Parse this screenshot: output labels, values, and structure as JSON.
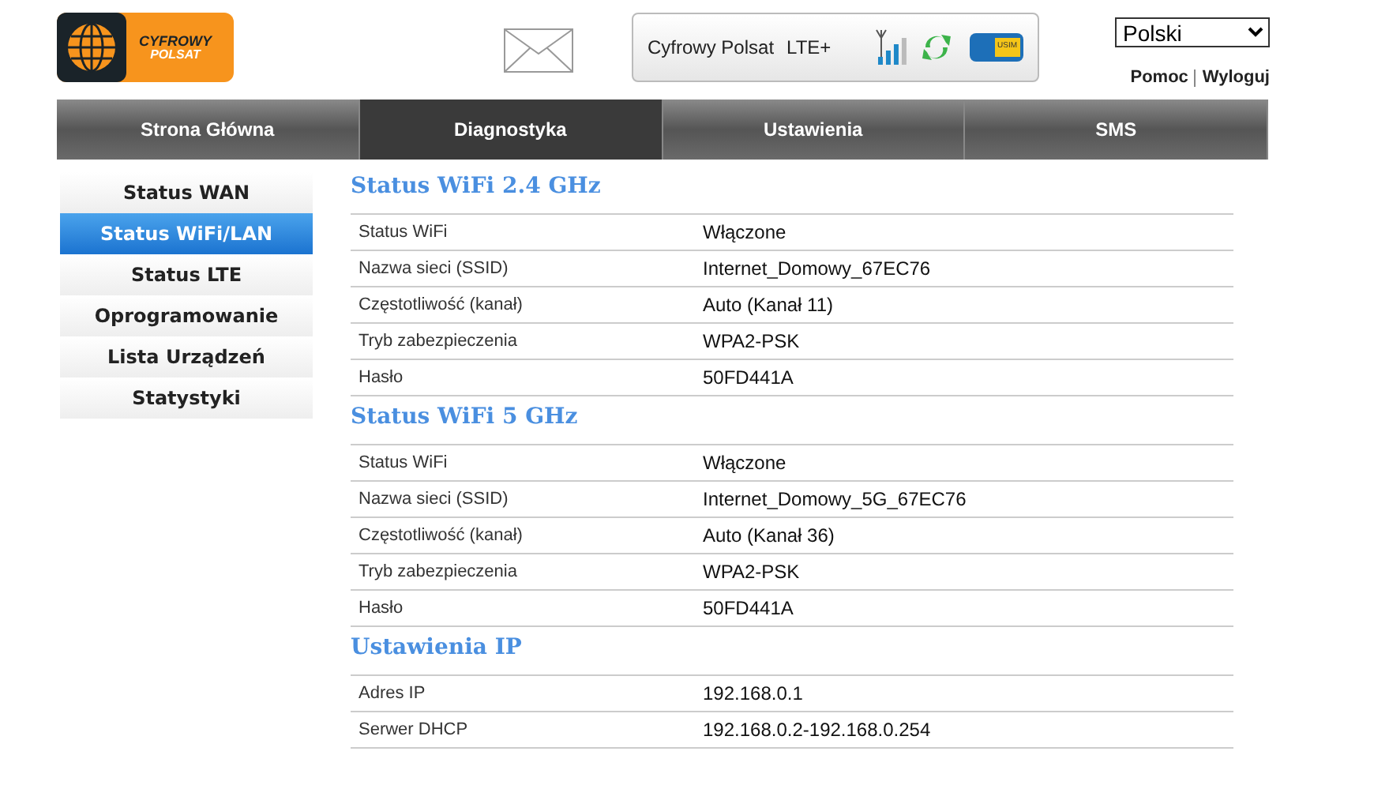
{
  "logo": {
    "line_1": "CYFROWY",
    "line_2": "POLSAT"
  },
  "status_box": {
    "operator": "Cyfrowy Polsat",
    "network": "LTE+",
    "sim": "USIM"
  },
  "language": {
    "value": "Polski"
  },
  "links": [
    "Pomoc",
    "Wyloguj"
  ],
  "tabs": [
    {
      "label": "Strona Główna",
      "selected": false
    },
    {
      "label": "Diagnostyka",
      "selected": true
    },
    {
      "label": "Ustawienia",
      "selected": false
    },
    {
      "label": "SMS",
      "selected": false
    }
  ],
  "sidebar": {
    "items": [
      {
        "label": "Status WAN",
        "selected": false
      },
      {
        "label": "Status WiFi/LAN",
        "selected": true
      },
      {
        "label": "Status LTE",
        "selected": false
      },
      {
        "label": "Oprogramowanie",
        "selected": false
      },
      {
        "label": "Lista Urządzeń",
        "selected": false
      },
      {
        "label": "Statystyki",
        "selected": false
      }
    ]
  },
  "sections": [
    {
      "title": "Status WiFi 2.4 GHz",
      "rows": [
        [
          "Status WiFi",
          "Włączone"
        ],
        [
          "Nazwa sieci (SSID)",
          "Internet_Domowy_67EC76"
        ],
        [
          "Częstotliwość (kanał)",
          "Auto (Kanał 11)"
        ],
        [
          "Tryb zabezpieczenia",
          "WPA2-PSK"
        ],
        [
          "Hasło",
          "50FD441A"
        ]
      ]
    },
    {
      "title": "Status WiFi 5 GHz",
      "rows": [
        [
          "Status WiFi",
          "Włączone"
        ],
        [
          "Nazwa sieci (SSID)",
          "Internet_Domowy_5G_67EC76"
        ],
        [
          "Częstotliwość (kanał)",
          "Auto (Kanał 36)"
        ],
        [
          "Tryb zabezpieczenia",
          "WPA2-PSK"
        ],
        [
          "Hasło",
          "50FD441A"
        ]
      ]
    },
    {
      "title": "Ustawienia IP",
      "rows": [
        [
          "Adres IP",
          "192.168.0.1"
        ],
        [
          "Serwer DHCP",
          "192.168.0.2-192.168.0.254"
        ]
      ]
    }
  ]
}
